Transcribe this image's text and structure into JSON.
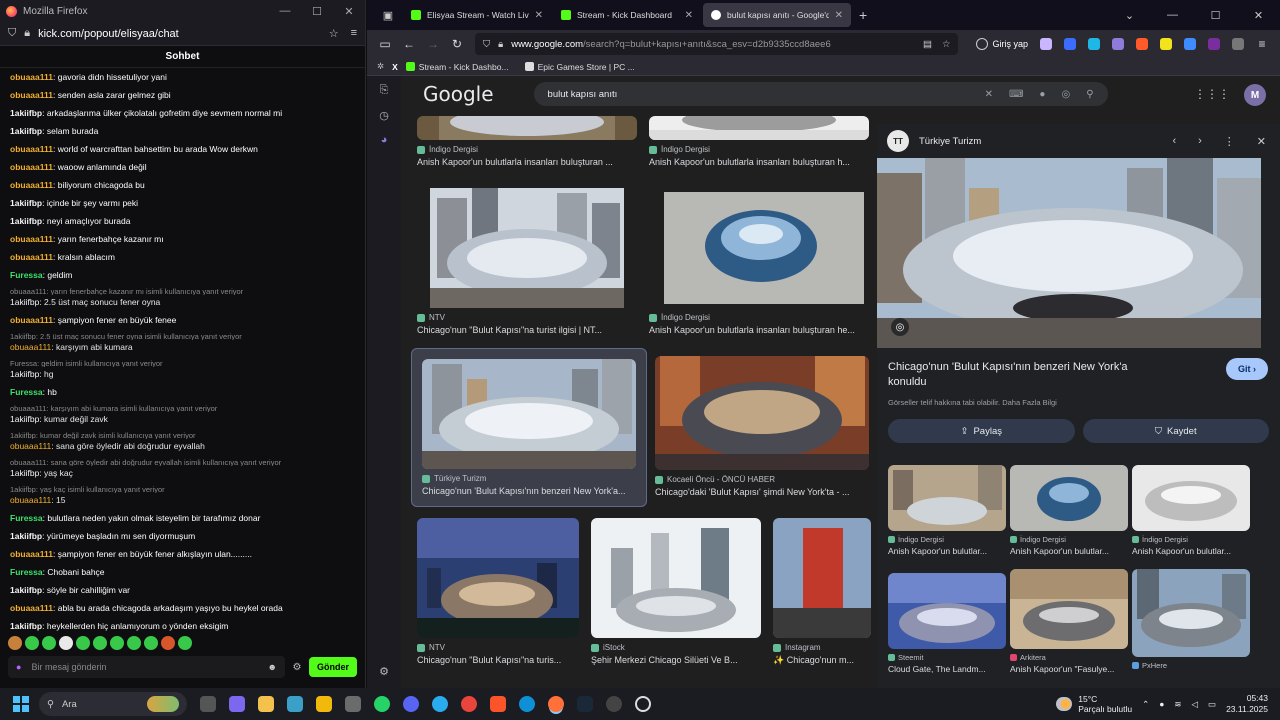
{
  "left_window": {
    "title": "Mozilla Firefox",
    "url": "kick.com/popout/elisyaa/chat",
    "chat_header": "Sohbet",
    "messages": [
      {
        "user": "obuaaa111",
        "sep": ": ",
        "text": "gavoria didn hissetuliyor yani",
        "kind": "obu"
      },
      {
        "user": "obuaaa111",
        "sep": ": ",
        "text": "senden asla zarar gelmez gibi",
        "kind": "obu"
      },
      {
        "user": "1akiifbp",
        "sep": ": ",
        "text": "arkadaşlarıma ülker çikolatalı gofretim diye sevmem normal mi",
        "kind": "1ak"
      },
      {
        "user": "1akiifbp",
        "sep": ": ",
        "text": "selam burada",
        "kind": "1ak"
      },
      {
        "user": "obuaaa111",
        "sep": ": ",
        "text": "world of warcrafttan bahsettim bu arada Wow derkwn",
        "kind": "obu"
      },
      {
        "user": "obuaaa111",
        "sep": ": ",
        "text": "waoow anlamında değil",
        "kind": "obu"
      },
      {
        "user": "obuaaa111",
        "sep": ": ",
        "text": "biliyorum chicagoda bu",
        "kind": "obu"
      },
      {
        "user": "1akiifbp",
        "sep": ": ",
        "text": "içinde bir şey varmı peki",
        "kind": "1ak"
      },
      {
        "user": "1akiifbp",
        "sep": ": ",
        "text": "neyi amaçlıyor burada",
        "kind": "1ak"
      },
      {
        "user": "obuaaa111",
        "sep": ": ",
        "text": "yarın fenerbahçe kazanır mı",
        "kind": "obu"
      },
      {
        "user": "obuaaa111",
        "sep": ": ",
        "text": "kralsın ablacım",
        "kind": "obu"
      },
      {
        "user": "Furessa",
        "sep": ": ",
        "text": "geldim",
        "kind": "fur"
      },
      {
        "reply": "obuaaa111: yarın fenerbahçe kazanır mı isimli kullanıcıya yanıt veriyor",
        "user": "1akiifbp",
        "sep": ": ",
        "text": "2.5 üst maç sonucu fener oyna",
        "kind": "1ak"
      },
      {
        "user": "obuaaa111",
        "sep": ": ",
        "text": "şampiyon fener en büyük fenee",
        "kind": "obu"
      },
      {
        "reply": "1akiifbp: 2.5 üst maç sonucu fener oyna isimli kullanıcıya yanıt veriyor",
        "user": "obuaaa111",
        "sep": ": ",
        "text": "karşıyım abi kumara",
        "kind": "obu"
      },
      {
        "reply": "Furessa: geldim isimli kullanıcıya yanıt veriyor",
        "user": "1akiifbp",
        "sep": ": ",
        "text": "hg",
        "kind": "1ak"
      },
      {
        "user": "Furessa",
        "sep": ": ",
        "text": "hb",
        "kind": "fur"
      },
      {
        "reply": "obuaaa111: karşıyım abi kumara isimli kullanıcıya yanıt veriyor",
        "user": "1akiifbp",
        "sep": ": ",
        "text": "kumar değil zavk",
        "kind": "1ak"
      },
      {
        "reply": "1akiifbp: kumar değil zavk isimli kullanıcıya yanıt veriyor",
        "user": "obuaaa111",
        "sep": ": ",
        "text": "sana göre öyledir abi doğrudur eyvallah",
        "kind": "obu"
      },
      {
        "reply": "obuaaa111: sana göre öyledir abi doğrudur eyvallah isimli kullanıcıya yanıt veriyor",
        "user": "1akiifbp",
        "sep": ": ",
        "text": "yaş kaç",
        "kind": "1ak"
      },
      {
        "reply": "1akiifbp: yaş kaç isimli kullanıcıya yanıt veriyor",
        "user": "obuaaa111",
        "sep": ": ",
        "text": "15",
        "kind": "obu"
      },
      {
        "user": "Furessa",
        "sep": ": ",
        "text": "bulutlara neden yakın olmak isteyelim bir tarafımız donar",
        "kind": "fur"
      },
      {
        "user": "1akiifbp",
        "sep": ": ",
        "text": "yürümeye başladın mı sen diyormuşum",
        "kind": "1ak"
      },
      {
        "user": "obuaaa111",
        "sep": ": ",
        "text": "şampiyon fener en büyük fener alkışlayın ulan.........",
        "kind": "obu"
      },
      {
        "user": "Furessa",
        "sep": ": ",
        "text": "Chobani bahçe",
        "kind": "fur"
      },
      {
        "user": "1akiifbp",
        "sep": ": ",
        "text": "söyle bir cahilliğim var",
        "kind": "1ak"
      },
      {
        "user": "obuaaa111",
        "sep": ": ",
        "text": "abla bu arada chicagoda arkadaşım yaşıyo bu heykel orada",
        "kind": "obu"
      },
      {
        "user": "1akiifbp",
        "sep": ": ",
        "text": "heykellerden hiç anlamıyorum o yönden eksigim",
        "kind": "1ak"
      }
    ],
    "input_placeholder": "Bir mesaj gönderin",
    "send_label": "Gönder"
  },
  "browser": {
    "tabs": [
      {
        "label": "Elisyaa Stream - Watch Live on",
        "color": "#53fc18"
      },
      {
        "label": "Stream - Kick Dashboard",
        "color": "#53fc18"
      },
      {
        "label": "bulut kapısı anıtı - Google'da Ar",
        "color": "#4285f4"
      }
    ],
    "url_host": "www.google.com",
    "url_rest": "/search?q=bulut+kapısı+anıtı&sca_esv=d2b9335ccd8aee6",
    "signin_label": "Giriş yap",
    "bookmarks": [
      {
        "label": "Stream - Kick Dashbo...",
        "color": "#53fc18"
      },
      {
        "label": "Epic Games Store | PC ...",
        "color": "#ddd"
      }
    ]
  },
  "google": {
    "logo": "Google",
    "query": "bulut kapısı anıtı",
    "user_initial": "M",
    "results": [
      {
        "source": "İndigo Dergisi",
        "caption": "Anish Kapoor'un bulutlarla insanları buluşturan ..."
      },
      {
        "source": "İndigo Dergisi",
        "caption": "Anish Kapoor'un bulutlarla insanları buluşturan h..."
      },
      {
        "source": "NTV",
        "caption": "Chicago'nun \"Bulut Kapısı\"na turist ilgisi | NT..."
      },
      {
        "source": "İndigo Dergisi",
        "caption": "Anish Kapoor'un bulutlarla insanları buluşturan he..."
      },
      {
        "source": "Türkiye Turizm",
        "caption": "Chicago'nun 'Bulut Kapısı'nın benzeri New York'a..."
      },
      {
        "source": "Kocaeli Öncü - ÖNCÜ HABER",
        "caption": "Chicago'daki 'Bulut Kapısı' şimdi New York'ta - ..."
      },
      {
        "source": "NTV",
        "caption": "Chicago'nun \"Bulut Kapısı\"na turis..."
      },
      {
        "source": "iStock",
        "caption": "Şehir Merkezi Chicago Silüeti Ve B..."
      },
      {
        "source": "Instagram",
        "caption": "✨ Chicago'nun m..."
      }
    ]
  },
  "detail": {
    "site": "Türkiye Turizm",
    "site_logo": "TT",
    "title": "Chicago'nun 'Bulut Kapısı'nın benzeri New York'a konuldu",
    "go_label": "Git",
    "note": "Görseller telif hakkına tabi olabilir. Daha Fazla Bilgi",
    "share_label": "Paylaş",
    "save_label": "Kaydet",
    "related": [
      {
        "source": "İndigo Dergisi",
        "caption": "Anish Kapoor'un bulutlar..."
      },
      {
        "source": "İndigo Dergisi",
        "caption": "Anish Kapoor'un bulutlar..."
      },
      {
        "source": "İndigo Dergisi",
        "caption": "Anish Kapoor'un bulutlar..."
      },
      {
        "source": "Steemit",
        "caption": "Cloud Gate, The Landm..."
      },
      {
        "source": "Arkitera",
        "caption": "Anish Kapoor'un \"Fasulye..."
      },
      {
        "source": "PxHere",
        "caption": ""
      }
    ]
  },
  "taskbar": {
    "search_label": "Ara",
    "temp": "15°C",
    "weather": "Parçalı bulutlu",
    "time": "05:43",
    "date": "23.11.2025"
  }
}
